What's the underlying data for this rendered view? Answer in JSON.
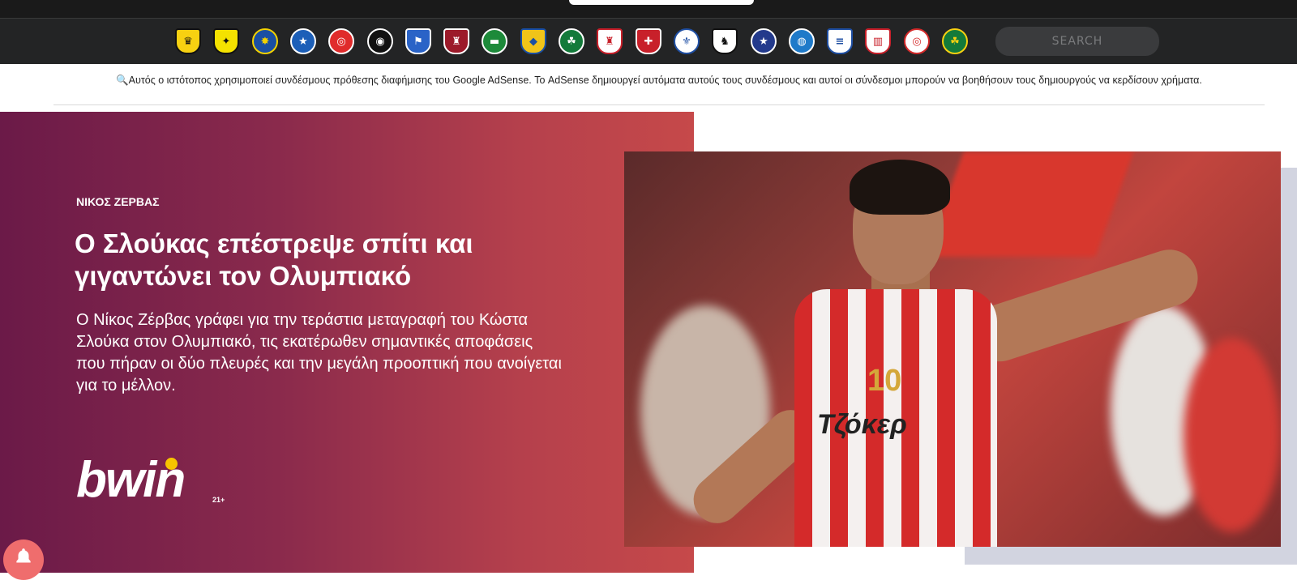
{
  "nav": {
    "teams": [
      {
        "name": "aek-icon",
        "bg": "#f7d111",
        "fg": "#111111",
        "glyph": "♛",
        "shape": "shield"
      },
      {
        "name": "aris-icon",
        "bg": "#f4e200",
        "fg": "#111111",
        "glyph": "✦",
        "shape": "shield"
      },
      {
        "name": "asteras-tripolis-icon",
        "bg": "#1a4fa3",
        "fg": "#f3d200",
        "glyph": "✸",
        "shape": "round"
      },
      {
        "name": "atromitos-icon",
        "bg": "#1c5fb8",
        "fg": "#ffffff",
        "glyph": "★",
        "shape": "round"
      },
      {
        "name": "olympiacos-icon",
        "bg": "#e02b2b",
        "fg": "#ffffff",
        "glyph": "◎",
        "shape": "round"
      },
      {
        "name": "ofi-icon",
        "bg": "#111111",
        "fg": "#ffffff",
        "glyph": "◉",
        "shape": "round"
      },
      {
        "name": "panaitolikos-icon",
        "bg": "#2a63c7",
        "fg": "#ffffff",
        "glyph": "⚑",
        "shape": "shield"
      },
      {
        "name": "larissa-icon",
        "bg": "#9c1a2a",
        "fg": "#ffffff",
        "glyph": "♜",
        "shape": "shield"
      },
      {
        "name": "levadiakos-icon",
        "bg": "#1d8a3a",
        "fg": "#ffffff",
        "glyph": "▬",
        "shape": "round"
      },
      {
        "name": "panetolikos-icon",
        "bg": "#f0c419",
        "fg": "#1a4fa3",
        "glyph": "◆",
        "shape": "shield"
      },
      {
        "name": "panathinaikos-icon",
        "bg": "#137a3a",
        "fg": "#ffffff",
        "glyph": "☘",
        "shape": "round"
      },
      {
        "name": "xanthi-icon",
        "bg": "#ffffff",
        "fg": "#c8202a",
        "glyph": "♜",
        "shape": "shield"
      },
      {
        "name": "panionios-icon",
        "bg": "#c8202a",
        "fg": "#ffffff",
        "glyph": "✚",
        "shape": "shield"
      },
      {
        "name": "iraklis-icon",
        "bg": "#ffffff",
        "fg": "#1f4fa3",
        "glyph": "⚜",
        "shape": "round"
      },
      {
        "name": "paok-icon",
        "bg": "#ffffff",
        "fg": "#111111",
        "glyph": "♞",
        "shape": "shield"
      },
      {
        "name": "apollon-icon",
        "bg": "#233a8c",
        "fg": "#ffffff",
        "glyph": "★",
        "shape": "round"
      },
      {
        "name": "pas-giannina-icon",
        "bg": "#1f7ac9",
        "fg": "#ffffff",
        "glyph": "◍",
        "shape": "round"
      },
      {
        "name": "lamia-icon",
        "bg": "#ffffff",
        "fg": "#1f4fa3",
        "glyph": "≡",
        "shape": "shield"
      },
      {
        "name": "volos-icon",
        "bg": "#ffffff",
        "fg": "#c8202a",
        "glyph": "▥",
        "shape": "shield"
      },
      {
        "name": "olympiacos-bc-icon",
        "bg": "#ffffff",
        "fg": "#d42a2a",
        "glyph": "◎",
        "shape": "round"
      },
      {
        "name": "panathinaikos-bc-icon",
        "bg": "#137a3a",
        "fg": "#f7d111",
        "glyph": "☘",
        "shape": "round"
      }
    ],
    "search_placeholder": "SEARCH"
  },
  "ad_notice": {
    "text": "🔍Αυτός ο ιστότοπος χρησιμοποιεί συνδέσμους πρόθεσης διαφήμισης του Google AdSense. Το AdSense δημιουργεί αυτόματα αυτούς τους συνδέσμους και αυτοί οι σύνδεσμοι μπορούν να βοηθήσουν τους δημιουργούς να κερδίσουν χρήματα."
  },
  "hero": {
    "author": "ΝΙΚΟΣ ΖΕΡΒΑΣ",
    "headline": "Ο Σλούκας επέστρεψε σπίτι και γιγαντώνει τον Ολυμπιακό",
    "lede": "Ο Νίκος Ζέρβας γράφει για την τεράστια μεταγραφή του Κώστα Σλούκα στον Ολυμπιακό, τις εκατέρωθεν σημαντικές αποφάσεις που πήραν οι δύο πλευρές και την μεγάλη προοπτική που ανοίγεται για το μέλλον.",
    "brand": "bwin",
    "age_badge": "21+",
    "photo": {
      "jersey_number": "10",
      "jersey_sponsor": "Τζόκερ"
    }
  },
  "colors": {
    "gradient_start": "#6b1a48",
    "gradient_end": "#c6494a",
    "brand_dot": "#f7c400",
    "bell": "#ef6d6d",
    "nav_bg": "#232425"
  }
}
